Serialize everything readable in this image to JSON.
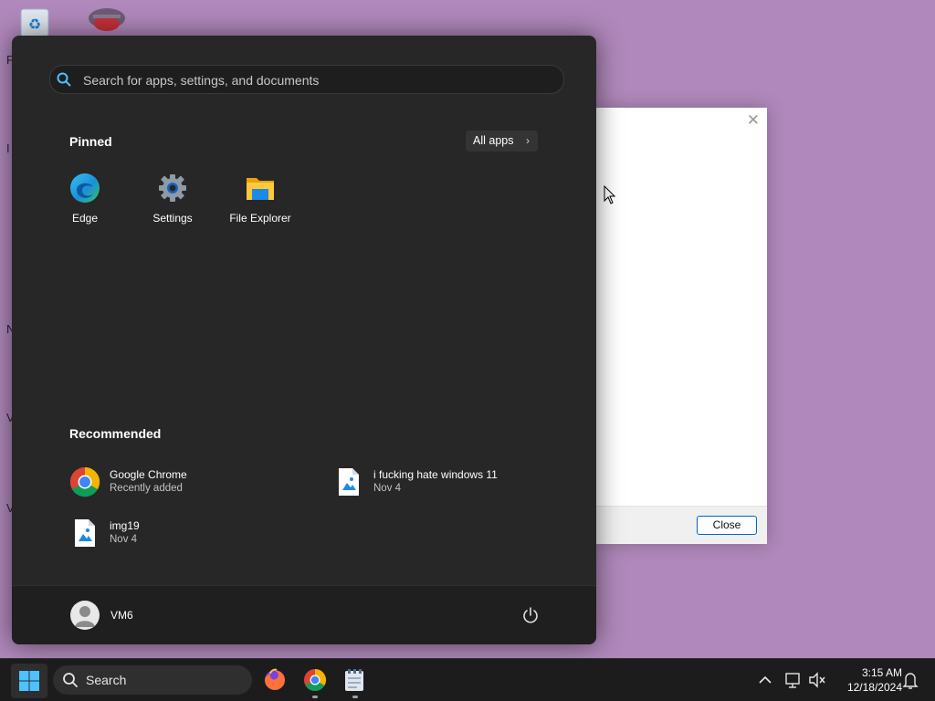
{
  "dialog": {
    "close_button_label": "Close"
  },
  "start_menu": {
    "search": {
      "placeholder": "Search for apps, settings, and documents",
      "icon": "search-icon"
    },
    "pinned": {
      "title": "Pinned",
      "all_apps_label": "All apps",
      "apps": [
        {
          "label": "Edge",
          "icon": "edge-icon"
        },
        {
          "label": "Settings",
          "icon": "settings-gear-icon"
        },
        {
          "label": "File Explorer",
          "icon": "folder-icon"
        }
      ]
    },
    "recommended": {
      "title": "Recommended",
      "items": [
        {
          "title": "Google Chrome",
          "subtitle": "Recently added",
          "icon": "chrome-icon"
        },
        {
          "title": "i fucking hate windows 11",
          "subtitle": "Nov 4",
          "icon": "image-file-icon"
        },
        {
          "title": "img19",
          "subtitle": "Nov 4",
          "icon": "image-file-icon"
        }
      ]
    },
    "user": {
      "name": "VM6"
    }
  },
  "taskbar": {
    "search_label": "Search",
    "apps": [
      "firefox-icon",
      "chrome-icon",
      "notepad-icon"
    ],
    "clock": {
      "time": "3:15 AM",
      "date": "12/18/2024"
    }
  },
  "colors": {
    "desktop": "#b088bb",
    "start_menu_bg": "#272727",
    "taskbar_bg": "#1c1c1c",
    "accent": "#0067c0"
  }
}
